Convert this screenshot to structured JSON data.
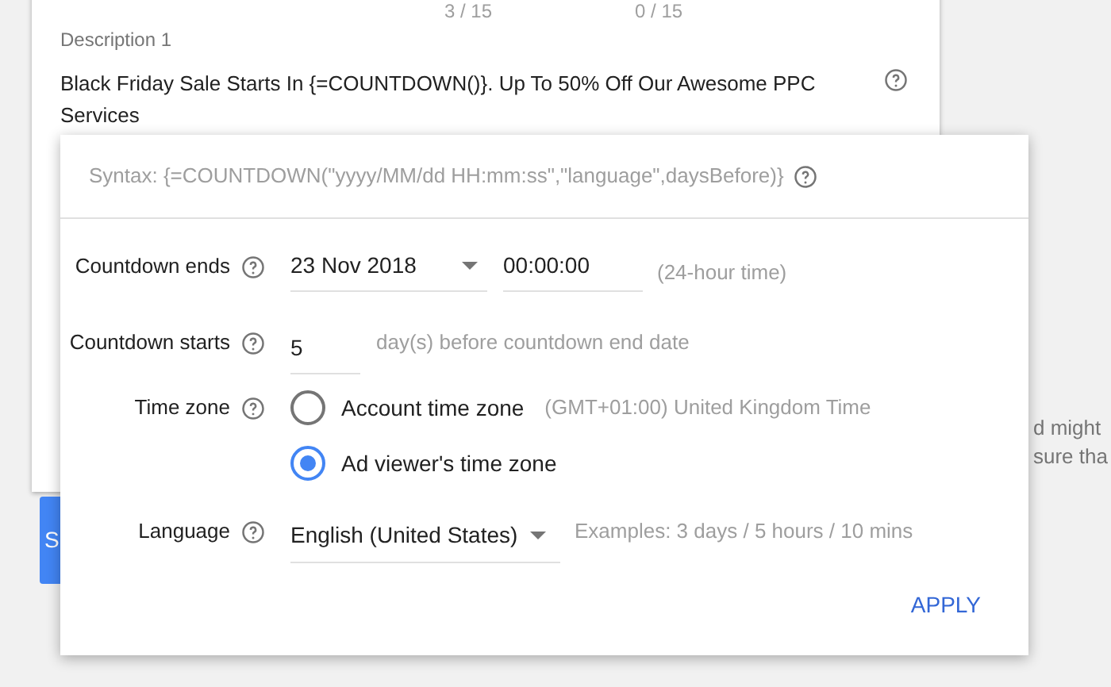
{
  "card": {
    "counters": [
      "3 / 15",
      "0 / 15"
    ],
    "description": {
      "label": "Description 1",
      "value": "Black Friday Sale Starts In {=COUNTDOWN()}. Up To 50% Off Our Awesome PPC Services"
    }
  },
  "side_text": [
    "d might",
    "sure tha"
  ],
  "button": {
    "label": "S"
  },
  "popup": {
    "syntax": "Syntax: {=COUNTDOWN(\"yyyy/MM/dd HH:mm:ss\",\"language\",daysBefore)}",
    "countdown_ends": {
      "label": "Countdown ends",
      "date": "23 Nov 2018",
      "time": "00:00:00",
      "hint": "(24-hour time)"
    },
    "countdown_starts": {
      "label": "Countdown starts",
      "value": "5",
      "hint": "day(s) before countdown end date"
    },
    "time_zone": {
      "label": "Time zone",
      "options": [
        {
          "label": "Account time zone",
          "detail": "(GMT+01:00) United Kingdom Time",
          "selected": false
        },
        {
          "label": "Ad viewer's time zone",
          "selected": true
        }
      ]
    },
    "language": {
      "label": "Language",
      "value": "English (United States)",
      "hint": "Examples: 3 days / 5 hours / 10 mins"
    },
    "apply": "APPLY"
  }
}
